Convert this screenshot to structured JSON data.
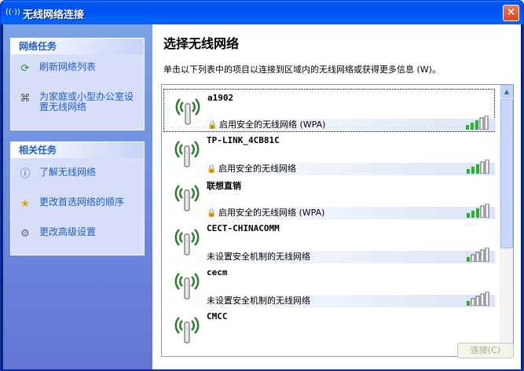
{
  "window": {
    "title": "无线网络连接",
    "title_icon": "wireless-icon"
  },
  "sidebar": {
    "network_tasks": {
      "header": "网络任务",
      "items": [
        {
          "label": "刷新网络列表",
          "icon": "refresh-icon"
        },
        {
          "label": "为家庭或小型办公室设置无线网络",
          "icon": "setup-icon"
        }
      ]
    },
    "related_tasks": {
      "header": "相关任务",
      "items": [
        {
          "label": "了解无线网络",
          "icon": "info-icon"
        },
        {
          "label": "更改首选网络的顺序",
          "icon": "star-icon"
        },
        {
          "label": "更改高级设置",
          "icon": "settings-icon"
        }
      ]
    }
  },
  "main": {
    "title": "选择无线网络",
    "subtitle": "单击以下列表中的项目以连接到区域内的无线网络或获得更多信息 (W)。",
    "networks": [
      {
        "name": "a1902",
        "security": "启用安全的无线网络 (WPA)",
        "secured": true
      },
      {
        "name": "TP-LINK_4CB81C",
        "security": "启用安全的无线网络",
        "secured": true
      },
      {
        "name": "联想直销",
        "security": "启用安全的无线网络 (WPA)",
        "secured": true
      },
      {
        "name": "CECT-CHINACOMM",
        "security": "未设置安全机制的无线网络",
        "secured": false
      },
      {
        "name": "cecm",
        "security": "未设置安全机制的无线网络",
        "secured": false
      },
      {
        "name": "CMCC",
        "security": "",
        "secured": false
      }
    ],
    "connect_label": "连接(C)"
  }
}
